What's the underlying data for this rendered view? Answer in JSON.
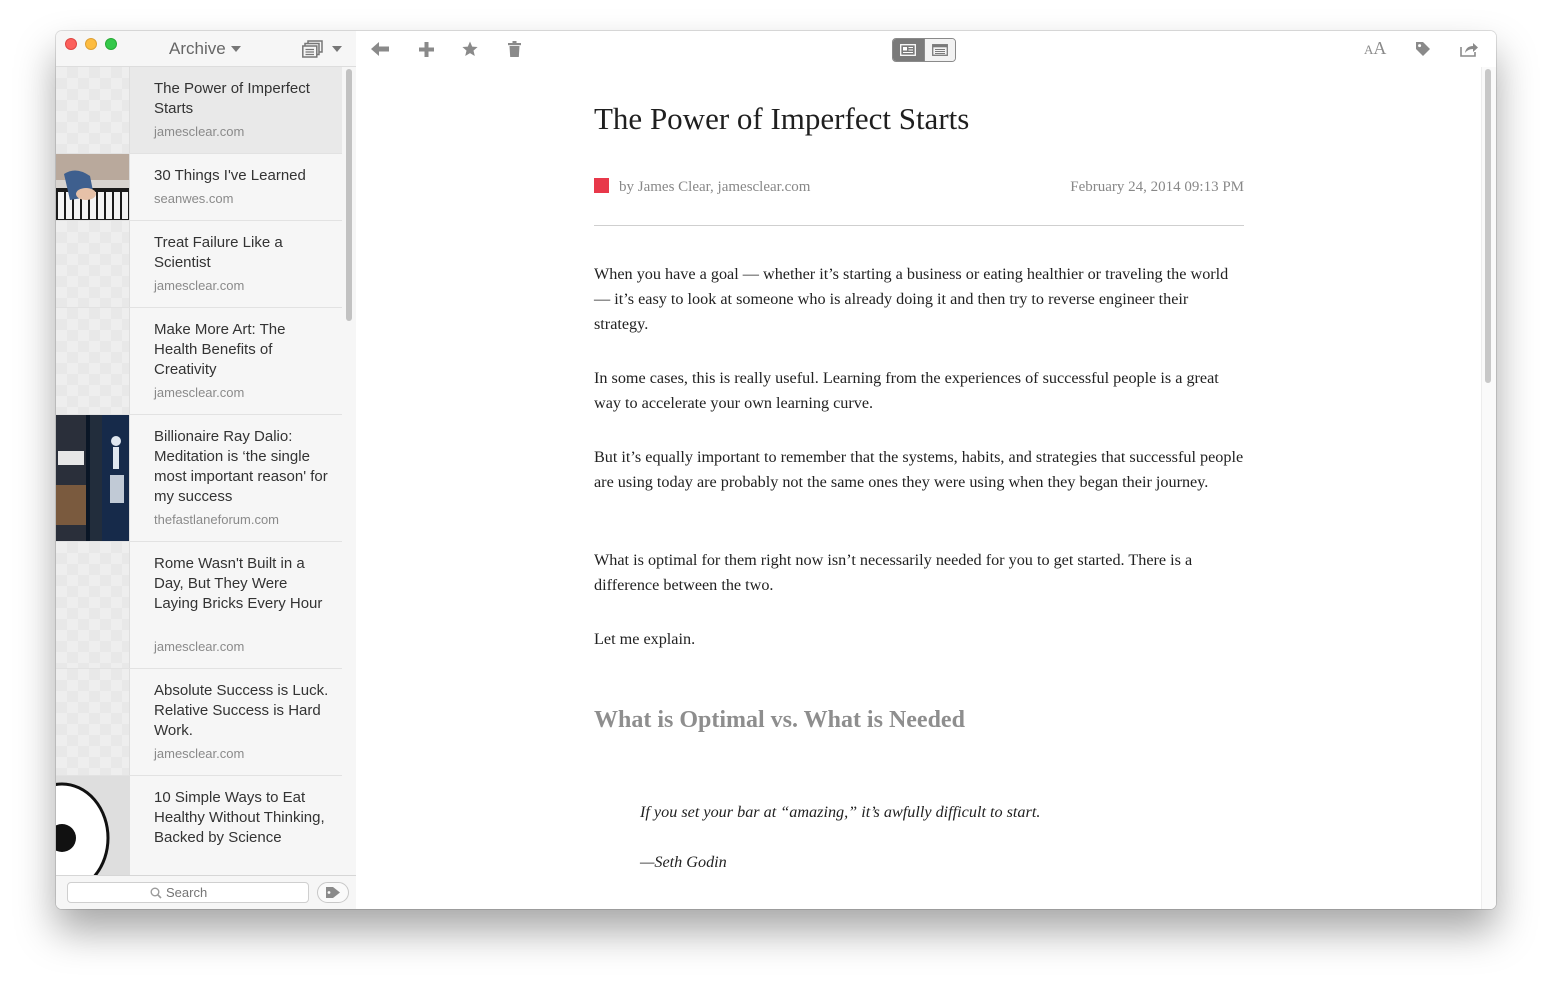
{
  "sidebar": {
    "folder_label": "Archive",
    "items": [
      {
        "title": "The Power of Imperfect Starts",
        "domain": "jamesclear.com"
      },
      {
        "title": "30 Things I've Learned",
        "domain": "seanwes.com"
      },
      {
        "title": "Treat Failure Like a Scientist",
        "domain": "jamesclear.com"
      },
      {
        "title": "Make More Art: The Health Benefits of Creativity",
        "domain": "jamesclear.com"
      },
      {
        "title": "Billionaire Ray Dalio: Meditation is ‘the single most important reason' for my success",
        "domain": "thefastlaneforum.com"
      },
      {
        "title": "Rome Wasn't Built in a Day, But They Were Laying Bricks Every Hour",
        "domain": "jamesclear.com"
      },
      {
        "title": "Absolute Success is Luck. Relative Success is Hard Work.",
        "domain": "jamesclear.com"
      },
      {
        "title": "10 Simple Ways to Eat Healthy Without Thinking, Backed by Science",
        "domain": ""
      }
    ],
    "search_placeholder": "Search"
  },
  "article": {
    "title": "The Power of Imperfect Starts",
    "byline": "by James Clear, jamesclear.com",
    "date": "February 24, 2014 09:13 PM",
    "paragraphs": [
      "When you have a goal — whether it’s starting a business or eating healthier or traveling the world — it’s easy to look at someone who is already doing it and then try to reverse engineer their strategy.",
      "In some cases, this is really useful. Learning from the experiences of successful people is a great way to accelerate your own learning curve.",
      "But it’s equally important to remember that the systems, habits, and strategies that successful people are using today are probably not the same ones they were using when they began their journey.",
      "What is optimal for them right now isn’t necessarily needed for you to get started. There is a difference between the two.",
      "Let me explain."
    ],
    "subheading": "What is Optimal vs. What is Needed",
    "quote": "If you set your bar at “amazing,” it’s awfully difficult to start.",
    "quote_author": "—Seth Godin"
  },
  "toolbar": {
    "font_size_small": "A",
    "font_size_large": "A"
  },
  "icons": {
    "back": "arrow-left-icon",
    "add": "plus-icon",
    "favorite": "star-icon",
    "delete": "trash-icon",
    "tag": "tag-icon",
    "share": "share-icon",
    "search": "magnifier-icon"
  },
  "colors": {
    "traffic_close": "#fc605c",
    "traffic_minimize": "#fdbc40",
    "traffic_maximize": "#34c84a",
    "source_swatch": "#e8384a",
    "toolbar_icon": "#8a8a8a"
  }
}
